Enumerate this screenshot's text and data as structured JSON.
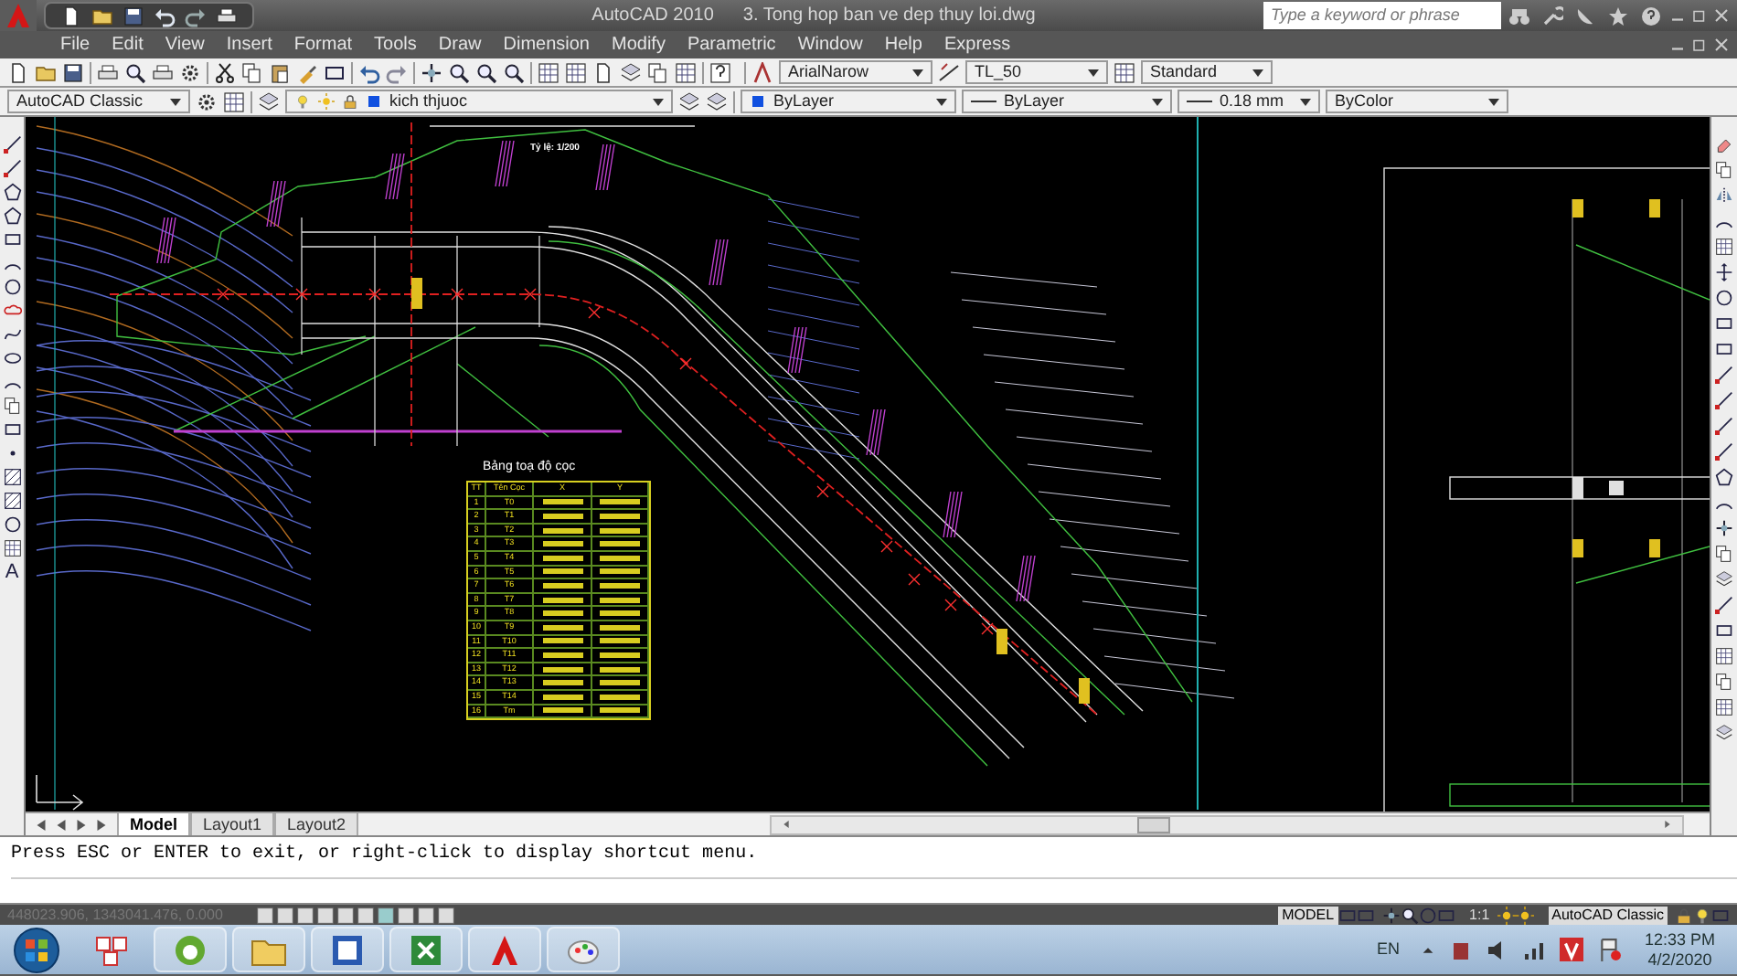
{
  "app": {
    "title": "AutoCAD 2010",
    "document": "3. Tong hop ban ve dep thuy loi.dwg",
    "search": {
      "placeholder": "Type a keyword or phrase"
    }
  },
  "menu": [
    "File",
    "Edit",
    "View",
    "Insert",
    "Format",
    "Tools",
    "Draw",
    "Dimension",
    "Modify",
    "Parametric",
    "Window",
    "Help",
    "Express"
  ],
  "styles_toolbar": {
    "text_style": "ArialNarow",
    "dim_style": "TL_50",
    "table_style": "Standard"
  },
  "properties_bar": {
    "workspace": "AutoCAD Classic",
    "layer": "kich thjuoc",
    "color_setting": "ByLayer",
    "linetype": "ByLayer",
    "lineweight": "0.18 mm",
    "plot_style": "ByColor"
  },
  "draw_palette": {
    "text_tool": "A"
  },
  "drawing": {
    "scale_note": "Tỷ lệ: 1/200",
    "table": {
      "title": "Bảng toạ độ cọc",
      "columns": [
        "TT",
        "Tên Cọc",
        "X",
        "Y"
      ],
      "rows": [
        {
          "tt": "1",
          "name": "T0"
        },
        {
          "tt": "2",
          "name": "T1"
        },
        {
          "tt": "3",
          "name": "T2"
        },
        {
          "tt": "4",
          "name": "T3"
        },
        {
          "tt": "5",
          "name": "T4"
        },
        {
          "tt": "6",
          "name": "T5"
        },
        {
          "tt": "7",
          "name": "T6"
        },
        {
          "tt": "8",
          "name": "T7"
        },
        {
          "tt": "9",
          "name": "T8"
        },
        {
          "tt": "10",
          "name": "T9"
        },
        {
          "tt": "11",
          "name": "T10"
        },
        {
          "tt": "12",
          "name": "T11"
        },
        {
          "tt": "13",
          "name": "T12"
        },
        {
          "tt": "14",
          "name": "T13"
        },
        {
          "tt": "15",
          "name": "T14"
        },
        {
          "tt": "16",
          "name": "Tm"
        }
      ]
    }
  },
  "layout_tabs": [
    {
      "label": "Model",
      "selected": true
    },
    {
      "label": "Layout1",
      "selected": false
    },
    {
      "label": "Layout2",
      "selected": false
    }
  ],
  "command_line": "Press ESC or ENTER to exit, or right-click to display shortcut menu.",
  "status_bar": {
    "coordinates": "448023.906, 1343041.476, 0.000",
    "space": "MODEL",
    "annotation_scale": "1:1",
    "workspace_switch": {
      "label": "AutoCAD Classic",
      "on": true
    }
  },
  "taskbar": {
    "language": "EN",
    "time": "12:33 PM",
    "date": "4/2/2020"
  }
}
